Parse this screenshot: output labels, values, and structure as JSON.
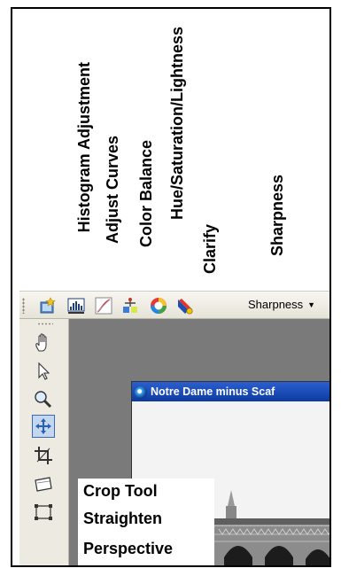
{
  "annotations": {
    "histogram": "Histogram Adjustment",
    "curves": "Adjust Curves",
    "color_balance": "Color Balance",
    "hue_sat": "Hue/Saturation/Lightness",
    "clarify": "Clarify",
    "sharpness": "Sharpness"
  },
  "toolbar": {
    "icons": [
      "auto-enhance-icon",
      "histogram-icon",
      "curves-icon",
      "color-balance-icon",
      "hue-saturation-icon",
      "clarify-icon"
    ],
    "sharpness_dropdown": "Sharpness"
  },
  "palette": {
    "tools": [
      "pan-hand-icon",
      "pointer-arrow-icon",
      "zoom-icon",
      "move-icon",
      "crop-icon",
      "straighten-icon",
      "perspective-icon"
    ],
    "selected": "move-icon"
  },
  "tool_labels": {
    "crop": "Crop Tool",
    "straighten": "Straighten",
    "perspective": "Perspective"
  },
  "document": {
    "title": "Notre Dame minus Scaf"
  },
  "colors": {
    "title_bar": "#1a4fc0",
    "workspace": "#7a7a7a",
    "toolbar": "#ece9d8",
    "selected_tool": "#c5d7ef"
  }
}
